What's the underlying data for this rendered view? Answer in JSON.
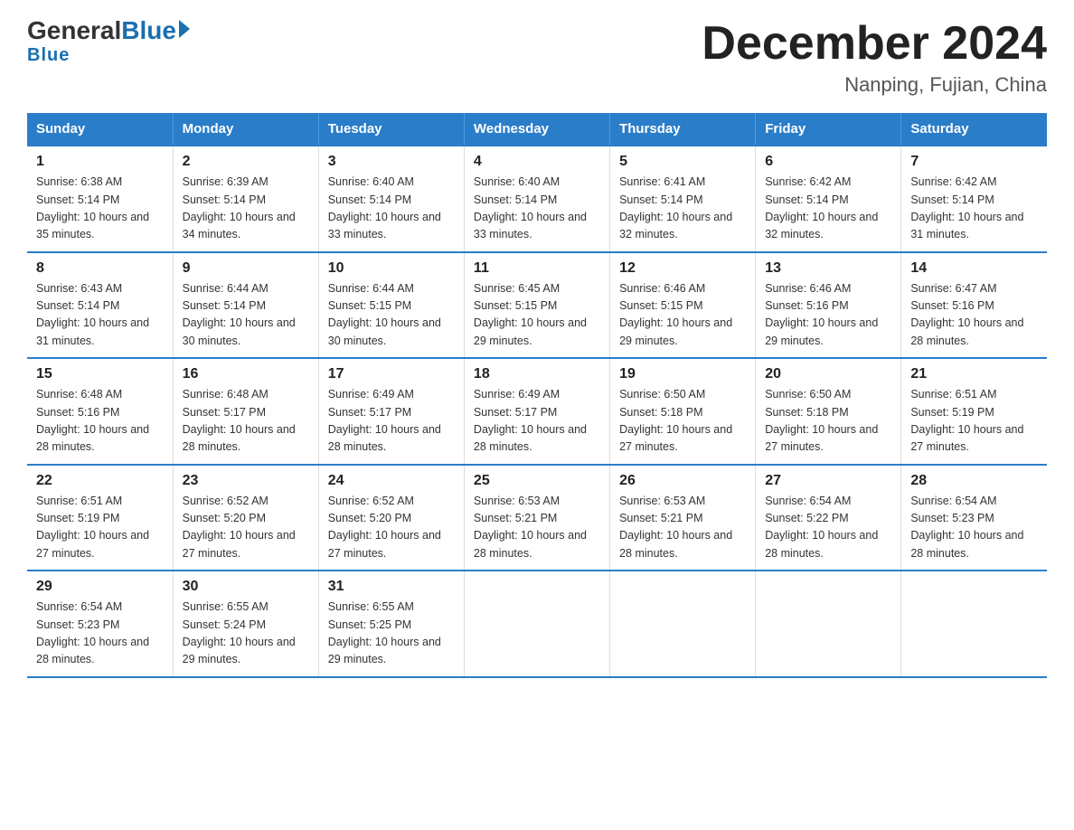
{
  "header": {
    "logo_general": "General",
    "logo_blue": "Blue",
    "month_year": "December 2024",
    "location": "Nanping, Fujian, China"
  },
  "weekdays": [
    "Sunday",
    "Monday",
    "Tuesday",
    "Wednesday",
    "Thursday",
    "Friday",
    "Saturday"
  ],
  "weeks": [
    [
      {
        "day": "1",
        "sunrise": "6:38 AM",
        "sunset": "5:14 PM",
        "daylight": "10 hours and 35 minutes."
      },
      {
        "day": "2",
        "sunrise": "6:39 AM",
        "sunset": "5:14 PM",
        "daylight": "10 hours and 34 minutes."
      },
      {
        "day": "3",
        "sunrise": "6:40 AM",
        "sunset": "5:14 PM",
        "daylight": "10 hours and 33 minutes."
      },
      {
        "day": "4",
        "sunrise": "6:40 AM",
        "sunset": "5:14 PM",
        "daylight": "10 hours and 33 minutes."
      },
      {
        "day": "5",
        "sunrise": "6:41 AM",
        "sunset": "5:14 PM",
        "daylight": "10 hours and 32 minutes."
      },
      {
        "day": "6",
        "sunrise": "6:42 AM",
        "sunset": "5:14 PM",
        "daylight": "10 hours and 32 minutes."
      },
      {
        "day": "7",
        "sunrise": "6:42 AM",
        "sunset": "5:14 PM",
        "daylight": "10 hours and 31 minutes."
      }
    ],
    [
      {
        "day": "8",
        "sunrise": "6:43 AM",
        "sunset": "5:14 PM",
        "daylight": "10 hours and 31 minutes."
      },
      {
        "day": "9",
        "sunrise": "6:44 AM",
        "sunset": "5:14 PM",
        "daylight": "10 hours and 30 minutes."
      },
      {
        "day": "10",
        "sunrise": "6:44 AM",
        "sunset": "5:15 PM",
        "daylight": "10 hours and 30 minutes."
      },
      {
        "day": "11",
        "sunrise": "6:45 AM",
        "sunset": "5:15 PM",
        "daylight": "10 hours and 29 minutes."
      },
      {
        "day": "12",
        "sunrise": "6:46 AM",
        "sunset": "5:15 PM",
        "daylight": "10 hours and 29 minutes."
      },
      {
        "day": "13",
        "sunrise": "6:46 AM",
        "sunset": "5:16 PM",
        "daylight": "10 hours and 29 minutes."
      },
      {
        "day": "14",
        "sunrise": "6:47 AM",
        "sunset": "5:16 PM",
        "daylight": "10 hours and 28 minutes."
      }
    ],
    [
      {
        "day": "15",
        "sunrise": "6:48 AM",
        "sunset": "5:16 PM",
        "daylight": "10 hours and 28 minutes."
      },
      {
        "day": "16",
        "sunrise": "6:48 AM",
        "sunset": "5:17 PM",
        "daylight": "10 hours and 28 minutes."
      },
      {
        "day": "17",
        "sunrise": "6:49 AM",
        "sunset": "5:17 PM",
        "daylight": "10 hours and 28 minutes."
      },
      {
        "day": "18",
        "sunrise": "6:49 AM",
        "sunset": "5:17 PM",
        "daylight": "10 hours and 28 minutes."
      },
      {
        "day": "19",
        "sunrise": "6:50 AM",
        "sunset": "5:18 PM",
        "daylight": "10 hours and 27 minutes."
      },
      {
        "day": "20",
        "sunrise": "6:50 AM",
        "sunset": "5:18 PM",
        "daylight": "10 hours and 27 minutes."
      },
      {
        "day": "21",
        "sunrise": "6:51 AM",
        "sunset": "5:19 PM",
        "daylight": "10 hours and 27 minutes."
      }
    ],
    [
      {
        "day": "22",
        "sunrise": "6:51 AM",
        "sunset": "5:19 PM",
        "daylight": "10 hours and 27 minutes."
      },
      {
        "day": "23",
        "sunrise": "6:52 AM",
        "sunset": "5:20 PM",
        "daylight": "10 hours and 27 minutes."
      },
      {
        "day": "24",
        "sunrise": "6:52 AM",
        "sunset": "5:20 PM",
        "daylight": "10 hours and 27 minutes."
      },
      {
        "day": "25",
        "sunrise": "6:53 AM",
        "sunset": "5:21 PM",
        "daylight": "10 hours and 28 minutes."
      },
      {
        "day": "26",
        "sunrise": "6:53 AM",
        "sunset": "5:21 PM",
        "daylight": "10 hours and 28 minutes."
      },
      {
        "day": "27",
        "sunrise": "6:54 AM",
        "sunset": "5:22 PM",
        "daylight": "10 hours and 28 minutes."
      },
      {
        "day": "28",
        "sunrise": "6:54 AM",
        "sunset": "5:23 PM",
        "daylight": "10 hours and 28 minutes."
      }
    ],
    [
      {
        "day": "29",
        "sunrise": "6:54 AM",
        "sunset": "5:23 PM",
        "daylight": "10 hours and 28 minutes."
      },
      {
        "day": "30",
        "sunrise": "6:55 AM",
        "sunset": "5:24 PM",
        "daylight": "10 hours and 29 minutes."
      },
      {
        "day": "31",
        "sunrise": "6:55 AM",
        "sunset": "5:25 PM",
        "daylight": "10 hours and 29 minutes."
      },
      null,
      null,
      null,
      null
    ]
  ],
  "labels": {
    "sunrise": "Sunrise:",
    "sunset": "Sunset:",
    "daylight": "Daylight:"
  }
}
